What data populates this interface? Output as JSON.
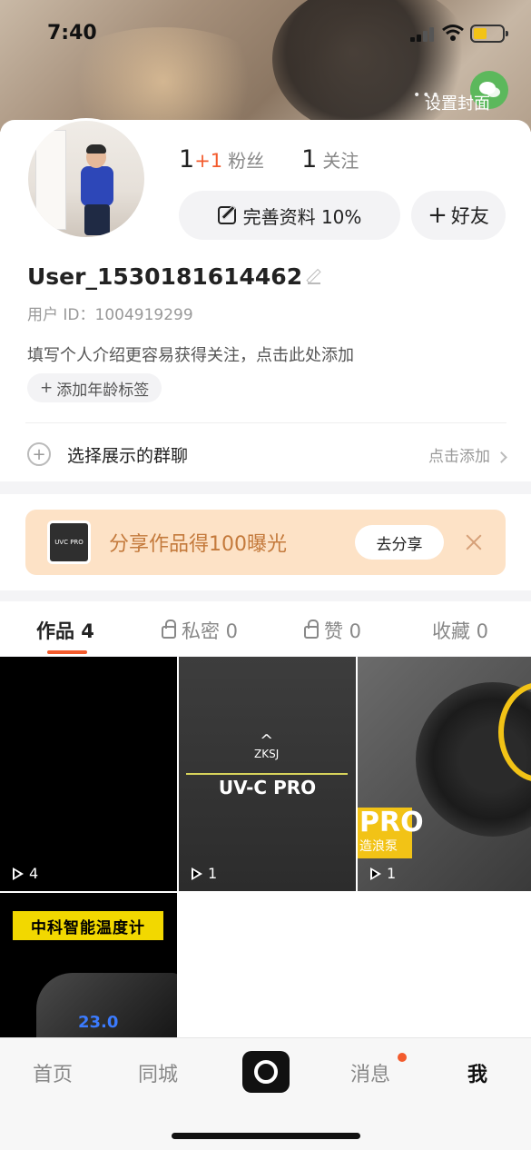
{
  "status_bar": {
    "time": "7:40"
  },
  "cover": {
    "set_cover_label": "设置封面",
    "more_dots": "•••"
  },
  "profile": {
    "fans_count": "1",
    "fans_delta": "+1",
    "fans_label": "粉丝",
    "following_count": "1",
    "following_label": "关注",
    "complete_profile_label": "完善资料 10%",
    "add_friend_label": "好友",
    "add_friend_prefix": "+",
    "username": "User_1530181614462",
    "user_id": "用户 ID：1004919299",
    "bio_placeholder": "填写个人介绍更容易获得关注，点击此处添加",
    "age_tag_label": "添加年龄标签",
    "age_tag_prefix": "+",
    "group_label": "选择展示的群聊",
    "group_action": "点击添加"
  },
  "share_banner": {
    "thumb_text": "UVC PRO",
    "text": "分享作品得100曝光",
    "button": "去分享"
  },
  "tabs": [
    {
      "label": "作品 4",
      "locked": false,
      "active": true
    },
    {
      "label": "私密 0",
      "locked": true,
      "active": false
    },
    {
      "label": "赞 0",
      "locked": true,
      "active": false
    },
    {
      "label": "收藏 0",
      "locked": false,
      "active": false
    }
  ],
  "videos": [
    {
      "plays": "4"
    },
    {
      "plays": "1",
      "logo": "ZKSJ",
      "brand": "UV-C PRO"
    },
    {
      "plays": "1",
      "tag_main": "PRO",
      "tag_sub": "造浪泵"
    },
    {
      "banner": "中科智能温度计",
      "digits": "23.0"
    }
  ],
  "bottom_nav": {
    "home": "首页",
    "local": "同城",
    "messages": "消息",
    "me": "我"
  },
  "colors": {
    "accent": "#f35b2d",
    "banner_bg": "#fde2c6",
    "banner_text": "#c47a3c"
  }
}
